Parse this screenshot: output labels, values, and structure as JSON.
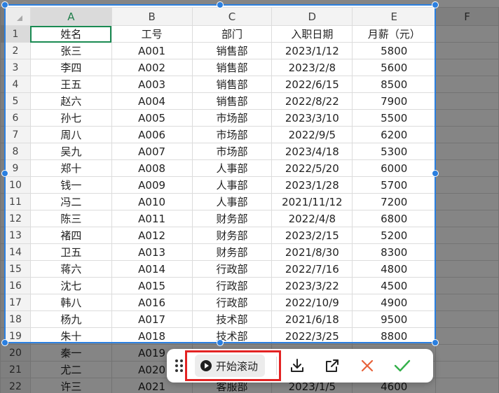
{
  "sheet": {
    "column_headers": [
      "A",
      "B",
      "C",
      "D",
      "E",
      "F"
    ],
    "rows": [
      {
        "n": "1",
        "cells": [
          "姓名",
          "工号",
          "部门",
          "入职日期",
          "月薪（元）"
        ]
      },
      {
        "n": "2",
        "cells": [
          "张三",
          "A001",
          "销售部",
          "2023/1/12",
          "5800"
        ]
      },
      {
        "n": "3",
        "cells": [
          "李四",
          "A002",
          "销售部",
          "2023/2/8",
          "5600"
        ]
      },
      {
        "n": "4",
        "cells": [
          "王五",
          "A003",
          "销售部",
          "2022/6/15",
          "8500"
        ]
      },
      {
        "n": "5",
        "cells": [
          "赵六",
          "A004",
          "销售部",
          "2022/8/22",
          "7900"
        ]
      },
      {
        "n": "6",
        "cells": [
          "孙七",
          "A005",
          "市场部",
          "2023/3/10",
          "5500"
        ]
      },
      {
        "n": "7",
        "cells": [
          "周八",
          "A006",
          "市场部",
          "2022/9/5",
          "6200"
        ]
      },
      {
        "n": "8",
        "cells": [
          "吴九",
          "A007",
          "市场部",
          "2023/4/18",
          "5300"
        ]
      },
      {
        "n": "9",
        "cells": [
          "郑十",
          "A008",
          "人事部",
          "2022/5/20",
          "6000"
        ]
      },
      {
        "n": "10",
        "cells": [
          "钱一",
          "A009",
          "人事部",
          "2023/1/28",
          "5700"
        ]
      },
      {
        "n": "11",
        "cells": [
          "冯二",
          "A010",
          "人事部",
          "2021/11/12",
          "7200"
        ]
      },
      {
        "n": "12",
        "cells": [
          "陈三",
          "A011",
          "财务部",
          "2022/4/8",
          "6800"
        ]
      },
      {
        "n": "13",
        "cells": [
          "褚四",
          "A012",
          "财务部",
          "2023/2/15",
          "5200"
        ]
      },
      {
        "n": "14",
        "cells": [
          "卫五",
          "A013",
          "财务部",
          "2021/8/30",
          "8300"
        ]
      },
      {
        "n": "15",
        "cells": [
          "蒋六",
          "A014",
          "行政部",
          "2022/7/16",
          "4800"
        ]
      },
      {
        "n": "16",
        "cells": [
          "沈七",
          "A015",
          "行政部",
          "2023/3/22",
          "4500"
        ]
      },
      {
        "n": "17",
        "cells": [
          "韩八",
          "A016",
          "行政部",
          "2022/10/9",
          "4900"
        ]
      },
      {
        "n": "18",
        "cells": [
          "杨九",
          "A017",
          "技术部",
          "2021/6/18",
          "9500"
        ]
      },
      {
        "n": "19",
        "cells": [
          "朱十",
          "A018",
          "技术部",
          "2022/3/25",
          "8800"
        ]
      },
      {
        "n": "20",
        "cells": [
          "秦一",
          "A019",
          "",
          "",
          ""
        ]
      },
      {
        "n": "21",
        "cells": [
          "尤二",
          "A020",
          "",
          "",
          ""
        ]
      },
      {
        "n": "22",
        "cells": [
          "许三",
          "A021",
          "客服部",
          "2023/1/5",
          "4600"
        ]
      }
    ],
    "active_cell": "A1"
  },
  "toolbar": {
    "scroll_label": "开始滚动",
    "icons": [
      "drag-handle-icon",
      "play-icon",
      "download-icon",
      "open-external-icon",
      "close-icon",
      "check-icon"
    ]
  },
  "colors": {
    "selection_border": "#2a7fe0",
    "active_cell_border": "#1a8a52",
    "highlight_box": "#e32323",
    "cancel": "#e8623a",
    "confirm": "#34b04a"
  }
}
